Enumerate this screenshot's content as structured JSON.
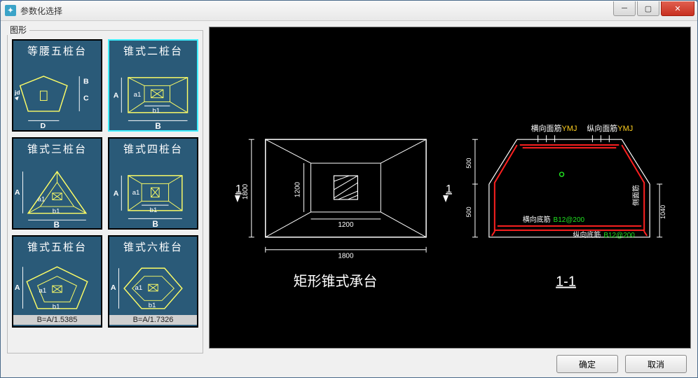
{
  "window": {
    "title": "参数化选择"
  },
  "leftpanel": {
    "label": "图形"
  },
  "thumbs": [
    {
      "label": "等腰五桩台",
      "dims": [
        "B",
        "C",
        "D",
        "jd"
      ]
    },
    {
      "label": "锥式二桩台",
      "dims": [
        "A",
        "a1",
        "b1",
        "B"
      ]
    },
    {
      "label": "锥式三桩台",
      "dims": [
        "A",
        "a1",
        "b1",
        "B"
      ]
    },
    {
      "label": "锥式四桩台",
      "dims": [
        "A",
        "a1",
        "b1",
        "B"
      ]
    },
    {
      "label": "锥式五桩台",
      "dims": [
        "A",
        "a1",
        "b1"
      ],
      "foot": "B=A/1.5385"
    },
    {
      "label": "锥式六桩台",
      "dims": [
        "A",
        "a1",
        "b1"
      ],
      "foot": "B=A/1.7326"
    }
  ],
  "preview": {
    "caption_left": "矩形锥式承台",
    "caption_right": "1-1",
    "section_marker": "1",
    "dims": {
      "outer_w": "1800",
      "outer_h": "1800",
      "inner_w": "1200",
      "inner_h": "1200",
      "sect_top": "500",
      "sect_bot": "500",
      "sect_right": "1040"
    },
    "labels": {
      "hx_top": "横向面筋",
      "hx_top_code": "YMJ",
      "zx_top": "纵向面筋",
      "zx_top_code": "YMJ",
      "hx_bot": "横向底筋",
      "hx_bot_code": "B12@200",
      "zx_bot": "纵向底筋",
      "zx_bot_code": "B12@200",
      "side": "侧面筋"
    }
  },
  "buttons": {
    "ok": "确定",
    "cancel": "取消"
  }
}
